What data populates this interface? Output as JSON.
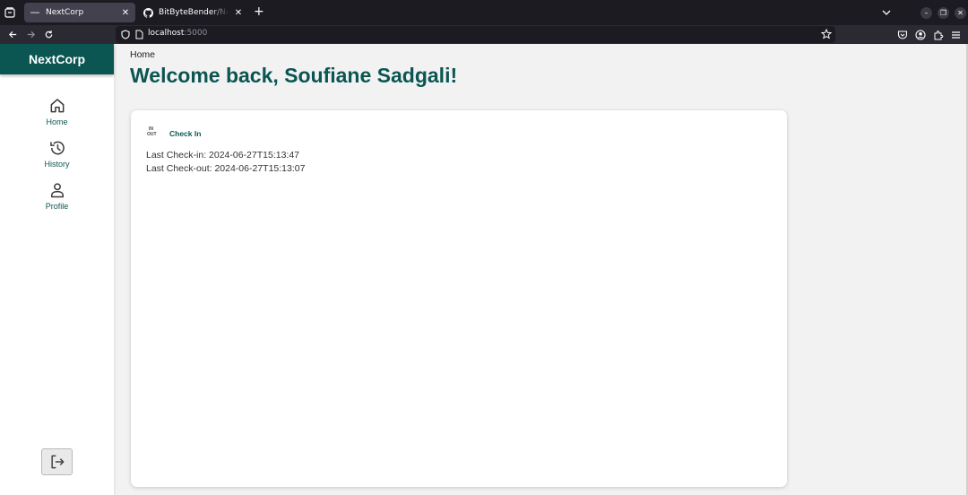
{
  "browser": {
    "tabs": [
      {
        "title": "NextCorp",
        "active": true,
        "favicon": "dash-favicon-icon"
      },
      {
        "title": "BitByteBender/Next_Corp",
        "active": false,
        "favicon": "github-icon"
      }
    ],
    "url": {
      "host": "localhost",
      "port": ":5000"
    }
  },
  "sidebar": {
    "brand": "NextCorp",
    "items": [
      {
        "label": "Home",
        "icon": "home-icon"
      },
      {
        "label": "History",
        "icon": "history-icon"
      },
      {
        "label": "Profile",
        "icon": "user-icon"
      }
    ],
    "logout_icon": "logout-icon"
  },
  "main": {
    "breadcrumb": "Home",
    "welcome": "Welcome back, Soufiane Sadgali!",
    "card": {
      "inout_in": "IN",
      "inout_out": "OUT",
      "checkin_label": "Check In",
      "last_checkin": "Last Check-in: 2024-06-27T15:13:47",
      "last_checkout": "Last Check-out: 2024-06-27T15:13:07"
    }
  },
  "colors": {
    "brand": "#0b5552",
    "page_bg": "#f2f2f2",
    "card_bg": "#ffffff"
  }
}
